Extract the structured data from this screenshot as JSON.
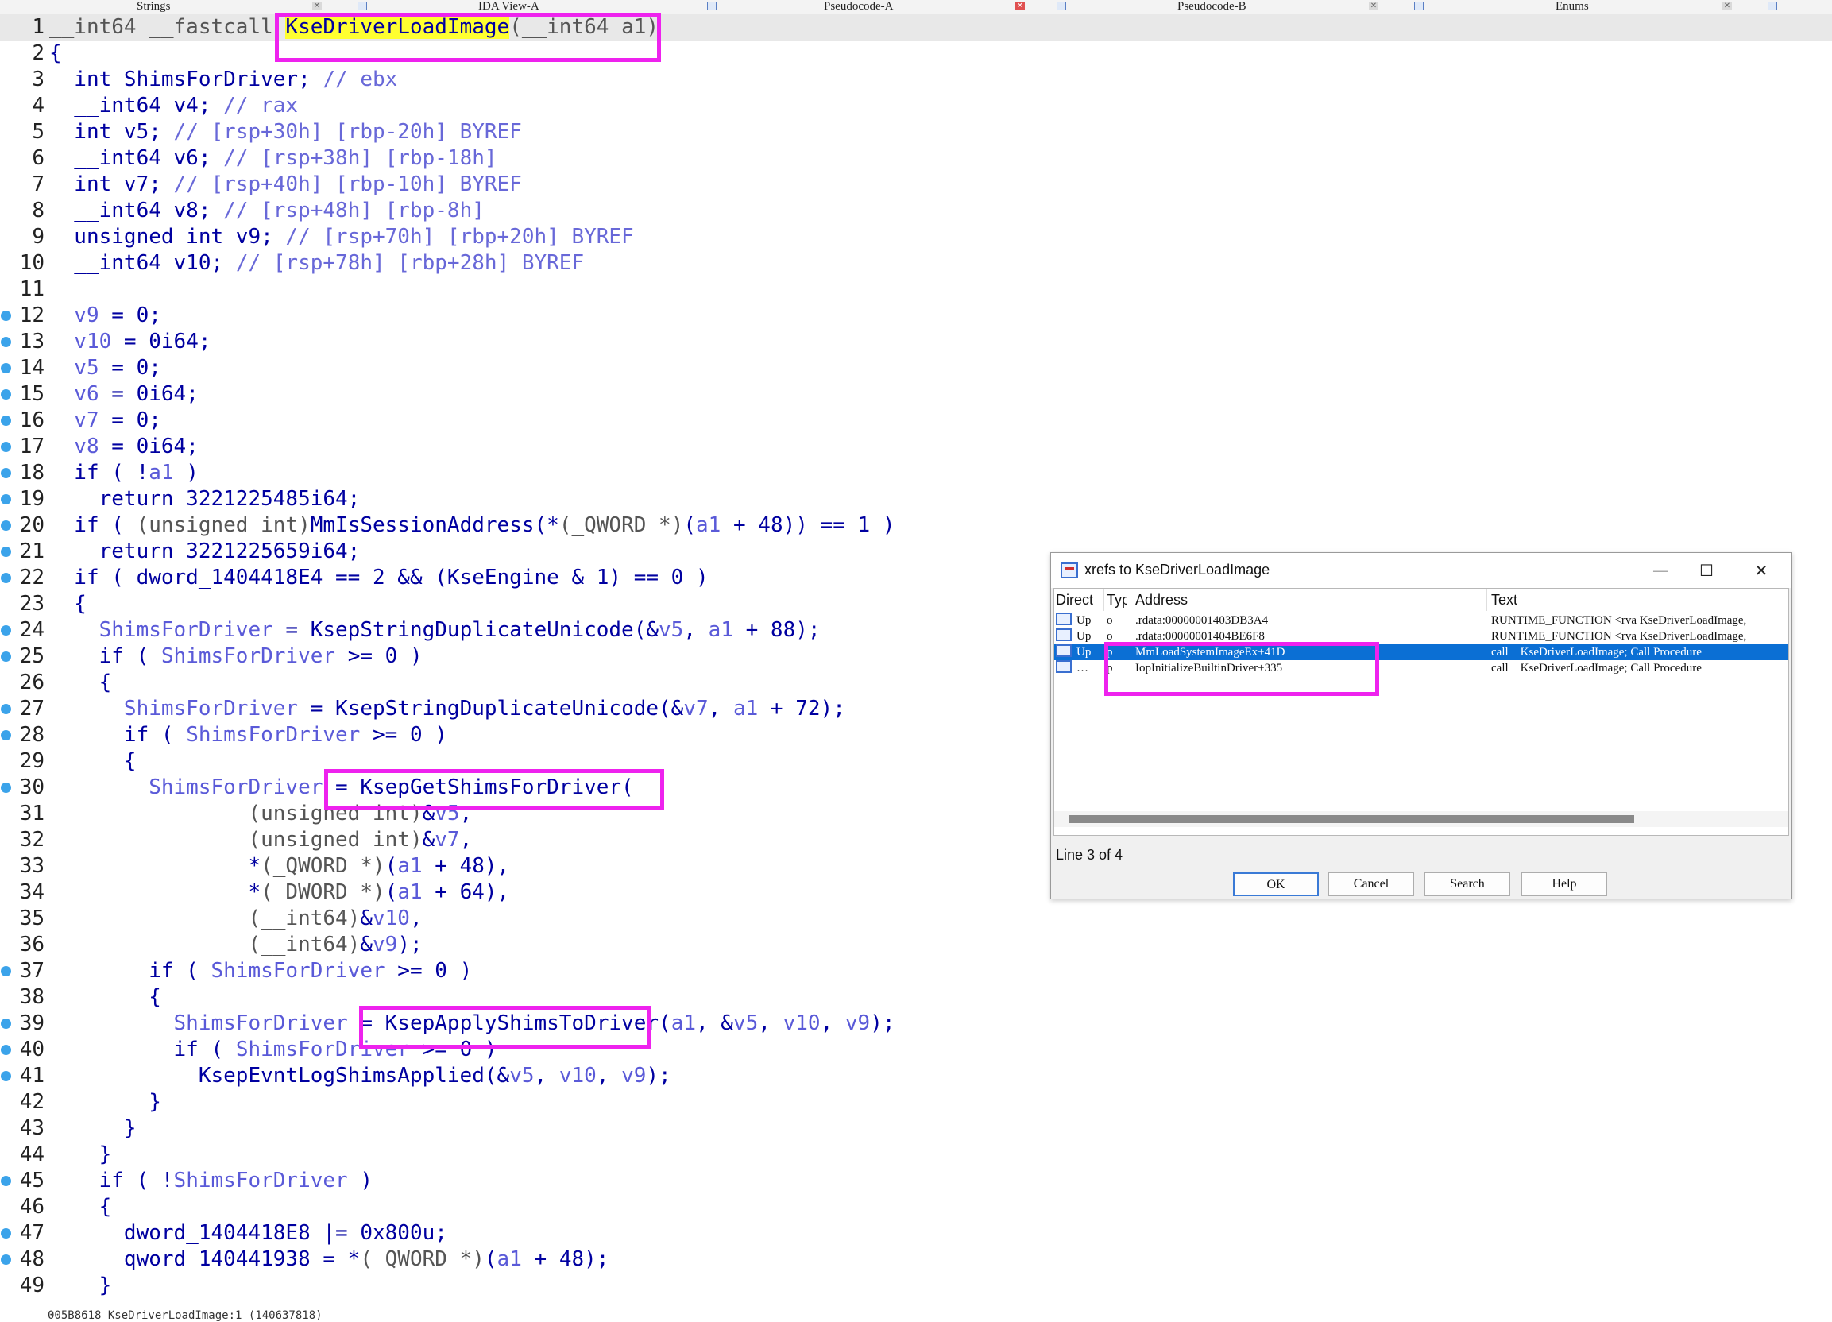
{
  "tabs": [
    {
      "label": "Strings"
    },
    {
      "label": "IDA View-A"
    },
    {
      "label": "Pseudocode-A"
    },
    {
      "label": "Pseudocode-B"
    },
    {
      "label": "Enums"
    }
  ],
  "code_lines": [
    {
      "n": "1",
      "bp": false,
      "segs": [
        [
          "gy",
          "__int64 __fastcall "
        ],
        [
          "fnhl",
          "KseDriverLoadImage"
        ],
        [
          "gy",
          "(__int64 a1)"
        ]
      ]
    },
    {
      "n": "2",
      "bp": false,
      "segs": [
        [
          "kw",
          "{"
        ]
      ]
    },
    {
      "n": "3",
      "bp": false,
      "segs": [
        [
          "kw",
          "  int ShimsForDriver; "
        ],
        [
          "cm",
          "// ebx"
        ]
      ]
    },
    {
      "n": "4",
      "bp": false,
      "segs": [
        [
          "kw",
          "  __int64 v4; "
        ],
        [
          "cm",
          "// rax"
        ]
      ]
    },
    {
      "n": "5",
      "bp": false,
      "segs": [
        [
          "kw",
          "  int v5; "
        ],
        [
          "cm",
          "// [rsp+30h] [rbp-20h] BYREF"
        ]
      ]
    },
    {
      "n": "6",
      "bp": false,
      "segs": [
        [
          "kw",
          "  __int64 v6; "
        ],
        [
          "cm",
          "// [rsp+38h] [rbp-18h]"
        ]
      ]
    },
    {
      "n": "7",
      "bp": false,
      "segs": [
        [
          "kw",
          "  int v7; "
        ],
        [
          "cm",
          "// [rsp+40h] [rbp-10h] BYREF"
        ]
      ]
    },
    {
      "n": "8",
      "bp": false,
      "segs": [
        [
          "kw",
          "  __int64 v8; "
        ],
        [
          "cm",
          "// [rsp+48h] [rbp-8h]"
        ]
      ]
    },
    {
      "n": "9",
      "bp": false,
      "segs": [
        [
          "kw",
          "  unsigned int v9; "
        ],
        [
          "cm",
          "// [rsp+70h] [rbp+20h] BYREF"
        ]
      ]
    },
    {
      "n": "10",
      "bp": false,
      "segs": [
        [
          "kw",
          "  __int64 v10; "
        ],
        [
          "cm",
          "// [rsp+78h] [rbp+28h] BYREF"
        ]
      ]
    },
    {
      "n": "11",
      "bp": false,
      "segs": [
        [
          "kw",
          ""
        ]
      ]
    },
    {
      "n": "12",
      "bp": true,
      "segs": [
        [
          "var",
          "  v9"
        ],
        [
          "kw",
          " = 0;"
        ]
      ]
    },
    {
      "n": "13",
      "bp": true,
      "segs": [
        [
          "var",
          "  v10"
        ],
        [
          "kw",
          " = 0i64;"
        ]
      ]
    },
    {
      "n": "14",
      "bp": true,
      "segs": [
        [
          "var",
          "  v5"
        ],
        [
          "kw",
          " = 0;"
        ]
      ]
    },
    {
      "n": "15",
      "bp": true,
      "segs": [
        [
          "var",
          "  v6"
        ],
        [
          "kw",
          " = 0i64;"
        ]
      ]
    },
    {
      "n": "16",
      "bp": true,
      "segs": [
        [
          "var",
          "  v7"
        ],
        [
          "kw",
          " = 0;"
        ]
      ]
    },
    {
      "n": "17",
      "bp": true,
      "segs": [
        [
          "var",
          "  v8"
        ],
        [
          "kw",
          " = 0i64;"
        ]
      ]
    },
    {
      "n": "18",
      "bp": true,
      "segs": [
        [
          "kw",
          "  if ( !"
        ],
        [
          "var",
          "a1"
        ],
        [
          "kw",
          " )"
        ]
      ]
    },
    {
      "n": "19",
      "bp": true,
      "segs": [
        [
          "kw",
          "    return 3221225485i64;"
        ]
      ]
    },
    {
      "n": "20",
      "bp": true,
      "segs": [
        [
          "kw",
          "  if ( "
        ],
        [
          "gy",
          "(unsigned int)"
        ],
        [
          "kw",
          "MmIsSessionAddress(*"
        ],
        [
          "gy",
          "(_QWORD *)"
        ],
        [
          "kw",
          "("
        ],
        [
          "var",
          "a1"
        ],
        [
          "kw",
          " + 48)) == 1 )"
        ]
      ]
    },
    {
      "n": "21",
      "bp": true,
      "segs": [
        [
          "kw",
          "    return 3221225659i64;"
        ]
      ]
    },
    {
      "n": "22",
      "bp": true,
      "segs": [
        [
          "kw",
          "  if ( dword_1404418E4 == 2 && (KseEngine & 1) == 0 )"
        ]
      ]
    },
    {
      "n": "23",
      "bp": false,
      "segs": [
        [
          "kw",
          "  {"
        ]
      ]
    },
    {
      "n": "24",
      "bp": true,
      "segs": [
        [
          "var",
          "    ShimsForDriver"
        ],
        [
          "kw",
          " = KsepStringDuplicateUnicode(&"
        ],
        [
          "var",
          "v5"
        ],
        [
          "kw",
          ", "
        ],
        [
          "var",
          "a1"
        ],
        [
          "kw",
          " + 88);"
        ]
      ]
    },
    {
      "n": "25",
      "bp": true,
      "segs": [
        [
          "kw",
          "    if ( "
        ],
        [
          "var",
          "ShimsForDriver"
        ],
        [
          "kw",
          " >= 0 )"
        ]
      ]
    },
    {
      "n": "26",
      "bp": false,
      "segs": [
        [
          "kw",
          "    {"
        ]
      ]
    },
    {
      "n": "27",
      "bp": true,
      "segs": [
        [
          "var",
          "      ShimsForDriver"
        ],
        [
          "kw",
          " = KsepStringDuplicateUnicode(&"
        ],
        [
          "var",
          "v7"
        ],
        [
          "kw",
          ", "
        ],
        [
          "var",
          "a1"
        ],
        [
          "kw",
          " + 72);"
        ]
      ]
    },
    {
      "n": "28",
      "bp": true,
      "segs": [
        [
          "kw",
          "      if ( "
        ],
        [
          "var",
          "ShimsForDriver"
        ],
        [
          "kw",
          " >= 0 )"
        ]
      ]
    },
    {
      "n": "29",
      "bp": false,
      "segs": [
        [
          "kw",
          "      {"
        ]
      ]
    },
    {
      "n": "30",
      "bp": true,
      "segs": [
        [
          "var",
          "        ShimsForDriver"
        ],
        [
          "kw",
          " = KsepGetShimsForDriver("
        ]
      ]
    },
    {
      "n": "31",
      "bp": false,
      "segs": [
        [
          "gy",
          "                (unsigned int)"
        ],
        [
          "kw",
          "&"
        ],
        [
          "var",
          "v5"
        ],
        [
          "kw",
          ","
        ]
      ]
    },
    {
      "n": "32",
      "bp": false,
      "segs": [
        [
          "gy",
          "                (unsigned int)"
        ],
        [
          "kw",
          "&"
        ],
        [
          "var",
          "v7"
        ],
        [
          "kw",
          ","
        ]
      ]
    },
    {
      "n": "33",
      "bp": false,
      "segs": [
        [
          "kw",
          "                *"
        ],
        [
          "gy",
          "(_QWORD *)"
        ],
        [
          "kw",
          "("
        ],
        [
          "var",
          "a1"
        ],
        [
          "kw",
          " + 48),"
        ]
      ]
    },
    {
      "n": "34",
      "bp": false,
      "segs": [
        [
          "kw",
          "                *"
        ],
        [
          "gy",
          "(_DWORD *)"
        ],
        [
          "kw",
          "("
        ],
        [
          "var",
          "a1"
        ],
        [
          "kw",
          " + 64),"
        ]
      ]
    },
    {
      "n": "35",
      "bp": false,
      "segs": [
        [
          "gy",
          "                (__int64)"
        ],
        [
          "kw",
          "&"
        ],
        [
          "var",
          "v10"
        ],
        [
          "kw",
          ","
        ]
      ]
    },
    {
      "n": "36",
      "bp": false,
      "segs": [
        [
          "gy",
          "                (__int64)"
        ],
        [
          "kw",
          "&"
        ],
        [
          "var",
          "v9"
        ],
        [
          "kw",
          ");"
        ]
      ]
    },
    {
      "n": "37",
      "bp": true,
      "segs": [
        [
          "kw",
          "        if ( "
        ],
        [
          "var",
          "ShimsForDriver"
        ],
        [
          "kw",
          " >= 0 )"
        ]
      ]
    },
    {
      "n": "38",
      "bp": false,
      "segs": [
        [
          "kw",
          "        {"
        ]
      ]
    },
    {
      "n": "39",
      "bp": true,
      "segs": [
        [
          "var",
          "          ShimsForDriver"
        ],
        [
          "kw",
          " = KsepApplyShimsToDriver("
        ],
        [
          "var",
          "a1"
        ],
        [
          "kw",
          ", &"
        ],
        [
          "var",
          "v5"
        ],
        [
          "kw",
          ", "
        ],
        [
          "var",
          "v10"
        ],
        [
          "kw",
          ", "
        ],
        [
          "var",
          "v9"
        ],
        [
          "kw",
          ");"
        ]
      ]
    },
    {
      "n": "40",
      "bp": true,
      "segs": [
        [
          "kw",
          "          if ( "
        ],
        [
          "var",
          "ShimsForDriver"
        ],
        [
          "kw",
          " >= 0 )"
        ]
      ]
    },
    {
      "n": "41",
      "bp": true,
      "segs": [
        [
          "kw",
          "            KsepEvntLogShimsApplied(&"
        ],
        [
          "var",
          "v5"
        ],
        [
          "kw",
          ", "
        ],
        [
          "var",
          "v10"
        ],
        [
          "kw",
          ", "
        ],
        [
          "var",
          "v9"
        ],
        [
          "kw",
          ");"
        ]
      ]
    },
    {
      "n": "42",
      "bp": false,
      "segs": [
        [
          "kw",
          "        }"
        ]
      ]
    },
    {
      "n": "43",
      "bp": false,
      "segs": [
        [
          "kw",
          "      }"
        ]
      ]
    },
    {
      "n": "44",
      "bp": false,
      "segs": [
        [
          "kw",
          "    }"
        ]
      ]
    },
    {
      "n": "45",
      "bp": true,
      "segs": [
        [
          "kw",
          "    if ( !"
        ],
        [
          "var",
          "ShimsForDriver"
        ],
        [
          "kw",
          " )"
        ]
      ]
    },
    {
      "n": "46",
      "bp": false,
      "segs": [
        [
          "kw",
          "    {"
        ]
      ]
    },
    {
      "n": "47",
      "bp": true,
      "segs": [
        [
          "kw",
          "      dword_1404418E8 |= 0x800u;"
        ]
      ]
    },
    {
      "n": "48",
      "bp": true,
      "segs": [
        [
          "kw",
          "      qword_140441938 = *"
        ],
        [
          "gy",
          "(_QWORD *)"
        ],
        [
          "kw",
          "("
        ],
        [
          "var",
          "a1"
        ],
        [
          "kw",
          " + 48);"
        ]
      ]
    },
    {
      "n": "49",
      "bp": false,
      "segs": [
        [
          "kw",
          "    }"
        ]
      ]
    }
  ],
  "status_text": "005B8618 KseDriverLoadImage:1 (140637818)",
  "dialog": {
    "title": "xrefs to KseDriverLoadImage",
    "minimize": "—",
    "maximize": "☐",
    "close": "✕",
    "columns": [
      "Direct",
      "Typ",
      "Address",
      "Text"
    ],
    "rows": [
      {
        "dir": "Up",
        "type": "o",
        "address": ".rdata:00000001403DB3A4",
        "text": "RUNTIME_FUNCTION <rva KseDriverLoadImage,",
        "selected": false
      },
      {
        "dir": "Up",
        "type": "o",
        "address": ".rdata:00000001404BE6F8",
        "text": "RUNTIME_FUNCTION <rva KseDriverLoadImage,",
        "selected": false
      },
      {
        "dir": "Up",
        "type": "p",
        "address": "MmLoadSystemImageEx+41D",
        "text": "call    KseDriverLoadImage; Call Procedure",
        "selected": true
      },
      {
        "dir": "…",
        "type": "p",
        "address": "IopInitializeBuiltinDriver+335",
        "text": "call    KseDriverLoadImage; Call Procedure",
        "selected": false
      }
    ],
    "line_info": "Line 3 of 4",
    "buttons": {
      "ok": "OK",
      "cancel": "Cancel",
      "search": "Search",
      "help": "Help"
    }
  },
  "colors": {
    "accent_highlight": "#ee22ee",
    "selection": "#0b6fd4",
    "breakpoint": "#3ba3ea"
  }
}
